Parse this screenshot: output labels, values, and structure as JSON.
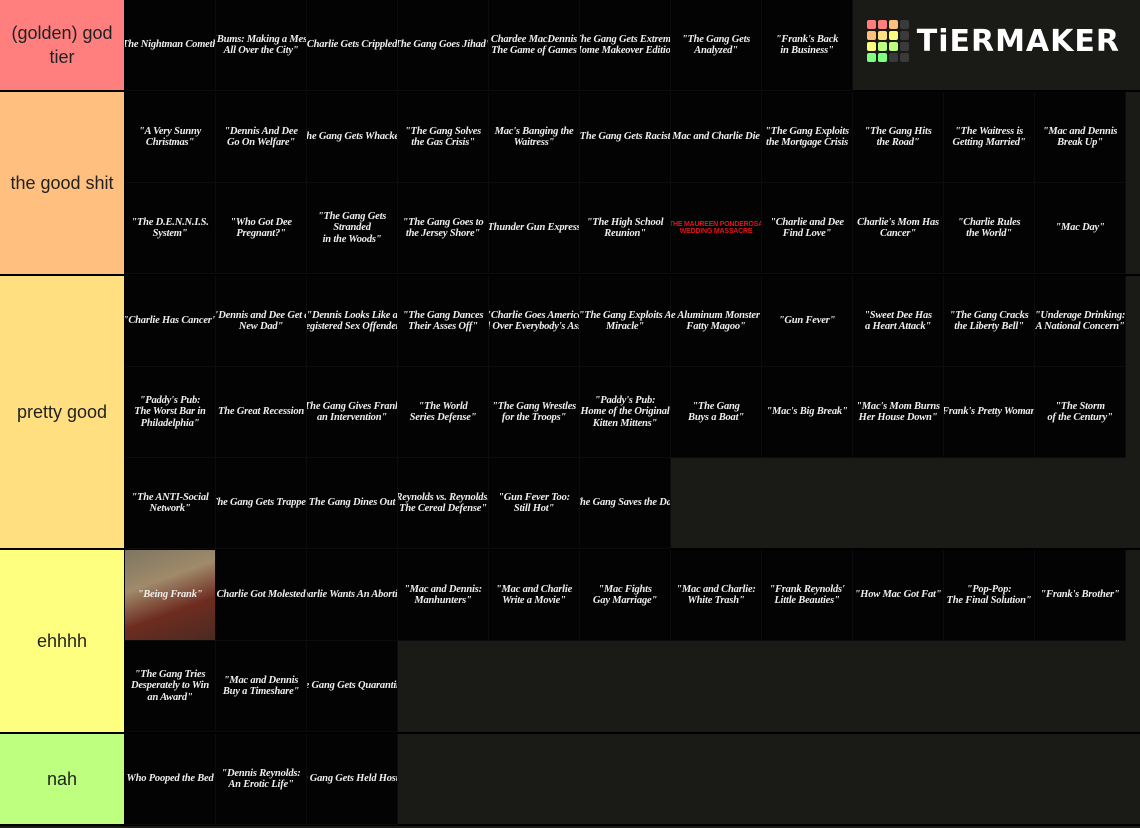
{
  "logo": {
    "text": "TiERMAKER",
    "colors": [
      "#ff7f7f",
      "#ff7f7f",
      "#ffbf7f",
      "#3a3a3a",
      "#ffbf7f",
      "#ffdf7f",
      "#ffff7f",
      "#3a3a3a",
      "#ffff7f",
      "#bfff7f",
      "#bfff7f",
      "#3a3a3a",
      "#7fff7f",
      "#7fff7f",
      "#3a3a3a",
      "#3a3a3a"
    ]
  },
  "tiers": [
    {
      "label": "(golden) god tier",
      "color": "#ff7f7f",
      "items": [
        "The Nightman Cometh",
        "\"Bums: Making a Mess\nAll Over the City\"",
        "Charlie Gets Crippled",
        "The Gang Goes Jihad\"",
        "Chardee MacDennis\nThe Game of Games",
        "The Gang Gets Extreme\nHome Makeover Edition",
        "\"The Gang Gets\nAnalyzed\"",
        "\"Frank's Back\nin Business\""
      ]
    },
    {
      "label": "the good shit",
      "color": "#ffbf7f",
      "items": [
        "\"A Very Sunny\nChristmas\"",
        "\"Dennis And Dee\nGo On Welfare\"",
        "The Gang Gets Whacked",
        "\"The Gang Solves\nthe Gas Crisis\"",
        "Mac's Banging the\nWaitress\"",
        "The Gang Gets Racist",
        "Mac and Charlie Die",
        "\"The Gang Exploits\nthe Mortgage Crisis",
        "\"The Gang Hits\nthe Road\"",
        "\"The Waitress is\nGetting Married\"",
        "\"Mac and Dennis\nBreak Up\"",
        "\"The D.E.N.N.I.S.\nSystem\"",
        "\"Who Got Dee\nPregnant?\"",
        "\"The Gang Gets\nStranded\nin the Woods\"",
        "\"The Gang Goes to\nthe Jersey Shore\"",
        "Thunder Gun Express",
        "\"The High School\nReunion\"",
        "THE MAUREEN PONDEROSA\nWEDDING MASSACRE",
        "\"Charlie and Dee\nFind Love\"",
        "Charlie's Mom Has\nCancer\"",
        "\"Charlie Rules\nthe World\"",
        "\"Mac Day\""
      ]
    },
    {
      "label": "pretty good",
      "color": "#ffdf7f",
      "items": [
        "\"Charlie Has Cancer\"",
        "\"Dennis and Dee Get a\nNew Dad\"",
        "\"Dennis Looks Like a\nRegistered Sex Offender\"",
        "\"The Gang Dances\nTheir Asses Off\"",
        "\"Charlie Goes America\nAll Over Everybody's Asses",
        "\"The Gang Exploits A\nMiracle\"",
        "The Aluminum Monster vs.\nFatty Magoo\"",
        "\"Gun Fever\"",
        "\"Sweet Dee Has\na Heart Attack\"",
        "\"The Gang Cracks\nthe Liberty Bell\"",
        "\"Underage Drinking:\nA National Concern\"",
        "\"Paddy's Pub:\nThe Worst Bar in\nPhiladelphia\"",
        "The Great Recession",
        "The Gang Gives Frank\nan Intervention\"",
        "\"The World\nSeries Defense\"",
        "\"The Gang Wrestles\nfor the Troops\"",
        "\"Paddy's Pub:\nHome of the Original\nKitten Mittens\"",
        "\"The Gang\nBuys a Boat\"",
        "\"Mac's Big Break\"",
        "\"Mac's Mom Burns\nHer House Down\"",
        "Frank's Pretty Woman",
        "\"The Storm\nof the Century\"",
        "\"The ANTI-Social\nNetwork\"",
        "The Gang Gets Trapped",
        "The Gang Dines Out",
        "Reynolds vs. Reynolds:\nThe Cereal Defense\"",
        "\"Gun Fever Too:\nStill Hot\"",
        "The Gang Saves the Day"
      ]
    },
    {
      "label": "ehhhh",
      "color": "#ffff7f",
      "items": [
        "\"Being Frank\"",
        "\"Charlie Got Molested\"",
        "Charlie Wants An Abortion",
        "\"Mac and Dennis:\nManhunters\"",
        "\"Mac and Charlie\nWrite a Movie\"",
        "\"Mac Fights\nGay Marriage\"",
        "\"Mac and Charlie:\nWhite Trash\"",
        "\"Frank Reynolds'\nLittle Beauties\"",
        "\"How Mac Got Fat\"",
        "\"Pop-Pop:\nThe Final Solution\"",
        "\"Frank's Brother\"",
        "\"The Gang Tries\nDesperately to Win\nan Award\"",
        "\"Mac and Dennis\nBuy a Timeshare\"",
        "The Gang Gets Quarantined"
      ]
    },
    {
      "label": "nah",
      "color": "#bfff7f",
      "items": [
        "Who Pooped the Bed",
        "\"Dennis Reynolds:\nAn Erotic Life\"",
        "The Gang Gets Held Hostage"
      ]
    }
  ]
}
